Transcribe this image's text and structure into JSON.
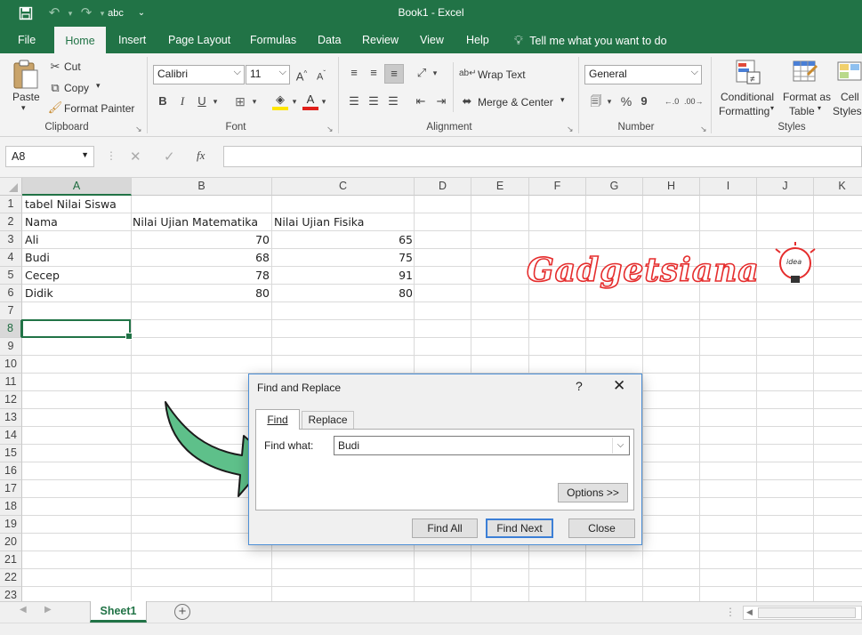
{
  "window": {
    "title": "Book1  -  Excel"
  },
  "quick_access": {
    "save_icon": "save-icon",
    "undo_icon": "undo-icon",
    "redo_icon": "redo-icon",
    "spelling_label": "abc"
  },
  "tabs": [
    "File",
    "Home",
    "Insert",
    "Page Layout",
    "Formulas",
    "Data",
    "Review",
    "View",
    "Help"
  ],
  "tell_me": "Tell me what you want to do",
  "ribbon": {
    "clipboard": {
      "paste": "Paste",
      "cut": "Cut",
      "copy": "Copy",
      "format_painter": "Format Painter",
      "group": "Clipboard"
    },
    "font": {
      "name": "Calibri",
      "size": "11",
      "bold": "B",
      "italic": "I",
      "underline": "U",
      "group": "Font"
    },
    "alignment": {
      "wrap": "Wrap Text",
      "merge": "Merge & Center",
      "group": "Alignment"
    },
    "number": {
      "format": "General",
      "percent": "%",
      "comma": "9",
      "group": "Number"
    },
    "styles": {
      "conditional": [
        "Conditional",
        "Formatting"
      ],
      "table": [
        "Format as",
        "Table"
      ],
      "cell": [
        "Cell",
        "Styles"
      ],
      "group": "Styles"
    }
  },
  "formula_bar": {
    "name_box": "A8",
    "fx": "fx",
    "formula": ""
  },
  "columns": [
    "A",
    "B",
    "C",
    "D",
    "E",
    "F",
    "G",
    "H",
    "I",
    "J",
    "K"
  ],
  "rows": [
    "1",
    "2",
    "3",
    "4",
    "5",
    "6",
    "7",
    "8",
    "9",
    "10",
    "11",
    "12",
    "13",
    "14",
    "15",
    "16",
    "17",
    "18",
    "19",
    "20",
    "21",
    "22",
    "23"
  ],
  "cells": {
    "A1": "tabel Nilai Siswa",
    "A2": "Nama",
    "B2": "Nilai Ujian Matematika",
    "C2": "Nilai Ujian Fisika",
    "A3": "Ali",
    "B3": "70",
    "C3": "65",
    "A4": "Budi",
    "B4": "68",
    "C4": "75",
    "A5": "Cecep",
    "B5": "78",
    "C5": "91",
    "A6": "Didik",
    "B6": "80",
    "C6": "80"
  },
  "selected_cell": "A8",
  "watermark": {
    "text": "Gadgetsiana",
    "badge": "idea"
  },
  "sheet_tabs": [
    "Sheet1"
  ],
  "dialog": {
    "title": "Find and Replace",
    "help": "?",
    "tab_find": "Find",
    "tab_replace": "Replace",
    "find_what_label": "Find what:",
    "find_what_value": "Budi",
    "options": "Options >>",
    "find_all": "Find All",
    "find_next": "Find Next",
    "close": "Close"
  },
  "colors": {
    "accent": "#217346",
    "arrow": "#5ec08a",
    "watermark": "#e52d2d"
  }
}
